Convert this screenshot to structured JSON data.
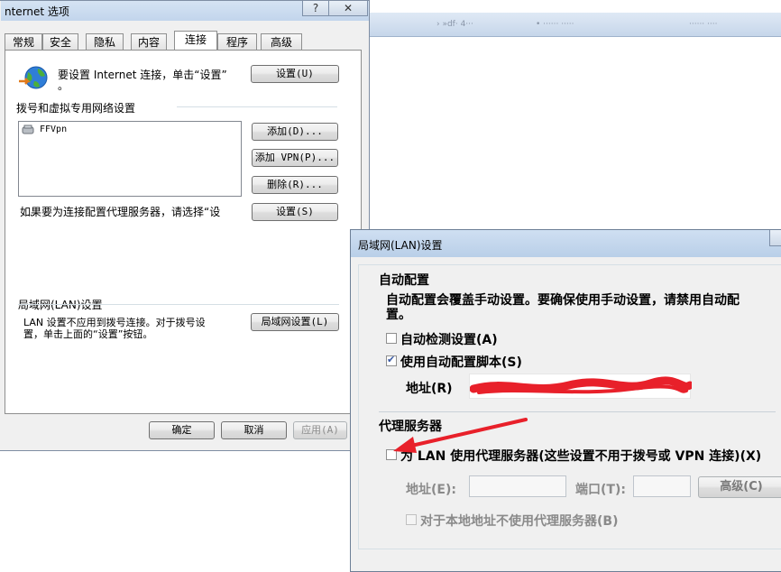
{
  "background_window": {
    "tabs": [
      "› »df· 4···",
      "• ······ ·····",
      "······ ····"
    ]
  },
  "internet_options": {
    "title": "nternet 选项",
    "help_glyph": "?",
    "close_glyph": "✕",
    "tabs": [
      "常规",
      "安全",
      "隐私",
      "内容",
      "连接",
      "程序",
      "高级"
    ],
    "setup_text_line1": "要设置 Internet 连接，单击“设置”",
    "setup_text_line2": "。",
    "setup_button": "设置(U)",
    "dialup_heading": "拨号和虚拟专用网络设置",
    "connections": [
      "FFVpn"
    ],
    "add_button": "添加(D)...",
    "add_vpn_button": "添加 VPN(P)...",
    "remove_button": "删除(R)...",
    "proxy_hint": "如果要为连接配置代理服务器，请选择“设",
    "proxy_hint_cont": "…",
    "settings_button": "设置(S)",
    "lan_heading": "局域网(LAN)设置",
    "lan_text_line1": "LAN 设置不应用到拨号连接。对于拨号设",
    "lan_text_line2": "置，单击上面的“设置”按钮。",
    "lan_button": "局域网设置(L)",
    "ok_button": "确定",
    "cancel_button": "取消",
    "apply_button": "应用(A)"
  },
  "lan_dialog": {
    "title": "局域网(LAN)设置",
    "auto_config_heading": "自动配置",
    "auto_config_desc_line1": "自动配置会覆盖手动设置。要确保使用手动设置，请禁用自动配",
    "auto_config_desc_line2": "置。",
    "auto_detect_label": "自动检测设置(A)",
    "auto_detect_checked": false,
    "use_script_label": "使用自动配置脚本(S)",
    "use_script_checked": true,
    "address_label": "地址(R)",
    "proxy_heading": "代理服务器",
    "use_proxy_label": "为 LAN 使用代理服务器(这些设置不用于拨号或 VPN 连接)(X)",
    "use_proxy_checked": false,
    "proxy_address_label": "地址(E):",
    "proxy_port_label": "端口(T):",
    "advanced_button": "高级(C)",
    "bypass_local_label": "对于本地地址不使用代理服务器(B)",
    "bypass_local_checked": false,
    "colors": {
      "redaction": "#e8202a",
      "arrow": "#e8202a"
    }
  }
}
